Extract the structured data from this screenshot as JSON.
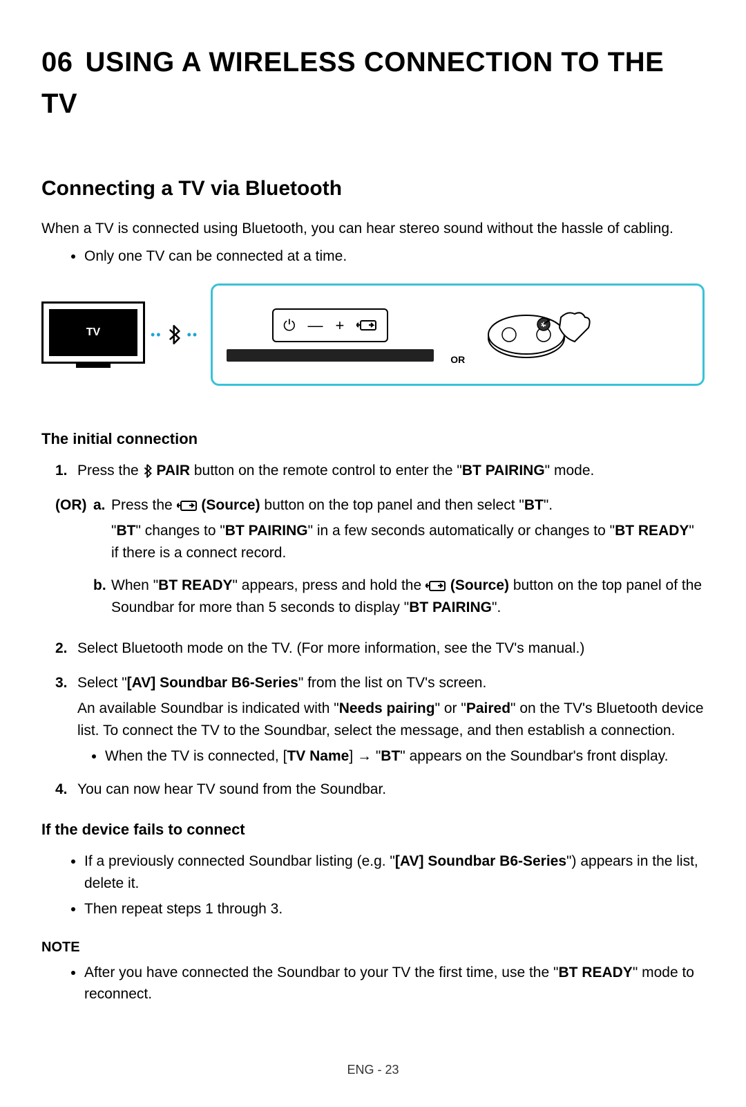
{
  "chapter": {
    "number": "06",
    "title": "USING A WIRELESS CONNECTION TO THE TV"
  },
  "section": {
    "title": "Connecting a TV via Bluetooth",
    "intro": "When a TV is connected using Bluetooth, you can hear stereo sound without the hassle of cabling.",
    "bullet1": "Only one TV can be connected at a time."
  },
  "diagram": {
    "tv_label": "TV",
    "or_label": "OR"
  },
  "initial": {
    "heading": "The initial connection",
    "step1_a": "Press the ",
    "step1_pair": "PAIR",
    "step1_b": " button on the remote control to enter the \"",
    "step1_bt_pairing": "BT PAIRING",
    "step1_c": "\" mode.",
    "or_label": "(OR)",
    "sub_a_1": "Press the ",
    "sub_a_source": "(Source)",
    "sub_a_2": " button on the top panel and then select \"",
    "sub_a_bt": "BT",
    "sub_a_3": "\".",
    "sub_a_line2_a": "\"",
    "sub_a_line2_bt": "BT",
    "sub_a_line2_b": "\" changes to \"",
    "sub_a_line2_pairing": "BT PAIRING",
    "sub_a_line2_c": "\" in a few seconds automatically or changes to \"",
    "sub_a_line2_ready": "BT READY",
    "sub_a_line2_d": "\" if there is a connect record.",
    "sub_b_1": "When \"",
    "sub_b_ready": "BT READY",
    "sub_b_2": "\" appears, press and hold the ",
    "sub_b_source": "(Source)",
    "sub_b_3": " button on the top panel of the Soundbar for more than 5 seconds to display \"",
    "sub_b_pairing": "BT PAIRING",
    "sub_b_4": "\".",
    "step2": "Select Bluetooth mode on the TV. (For more information, see the TV's manual.)",
    "step3_a": "Select \"",
    "step3_model": "[AV] Soundbar B6-Series",
    "step3_b": "\" from the list on TV's screen.",
    "step3_line2_a": "An available Soundbar is indicated with \"",
    "step3_needs": "Needs pairing",
    "step3_line2_b": "\" or \"",
    "step3_paired": "Paired",
    "step3_line2_c": "\" on the TV's Bluetooth device list. To connect the TV to the Soundbar, select the message, and then establish a connection.",
    "step3_bullet_a": "When the TV is connected, [",
    "step3_bullet_tvname": "TV Name",
    "step3_bullet_b": "] → \"",
    "step3_bullet_bt": "BT",
    "step3_bullet_c": "\" appears on the Soundbar's front display.",
    "step4": "You can now hear TV sound from the Soundbar."
  },
  "fails": {
    "heading": "If the device fails to connect",
    "bullet1_a": "If a previously connected Soundbar listing (e.g. \"",
    "bullet1_model": "[AV] Soundbar B6-Series",
    "bullet1_b": "\") appears in the list, delete it.",
    "bullet2": "Then repeat steps 1 through 3."
  },
  "note": {
    "heading": "NOTE",
    "bullet_a": "After you have connected the Soundbar to your TV the first time, use the \"",
    "bullet_ready": "BT READY",
    "bullet_b": "\" mode to reconnect."
  },
  "footer": "ENG - 23"
}
